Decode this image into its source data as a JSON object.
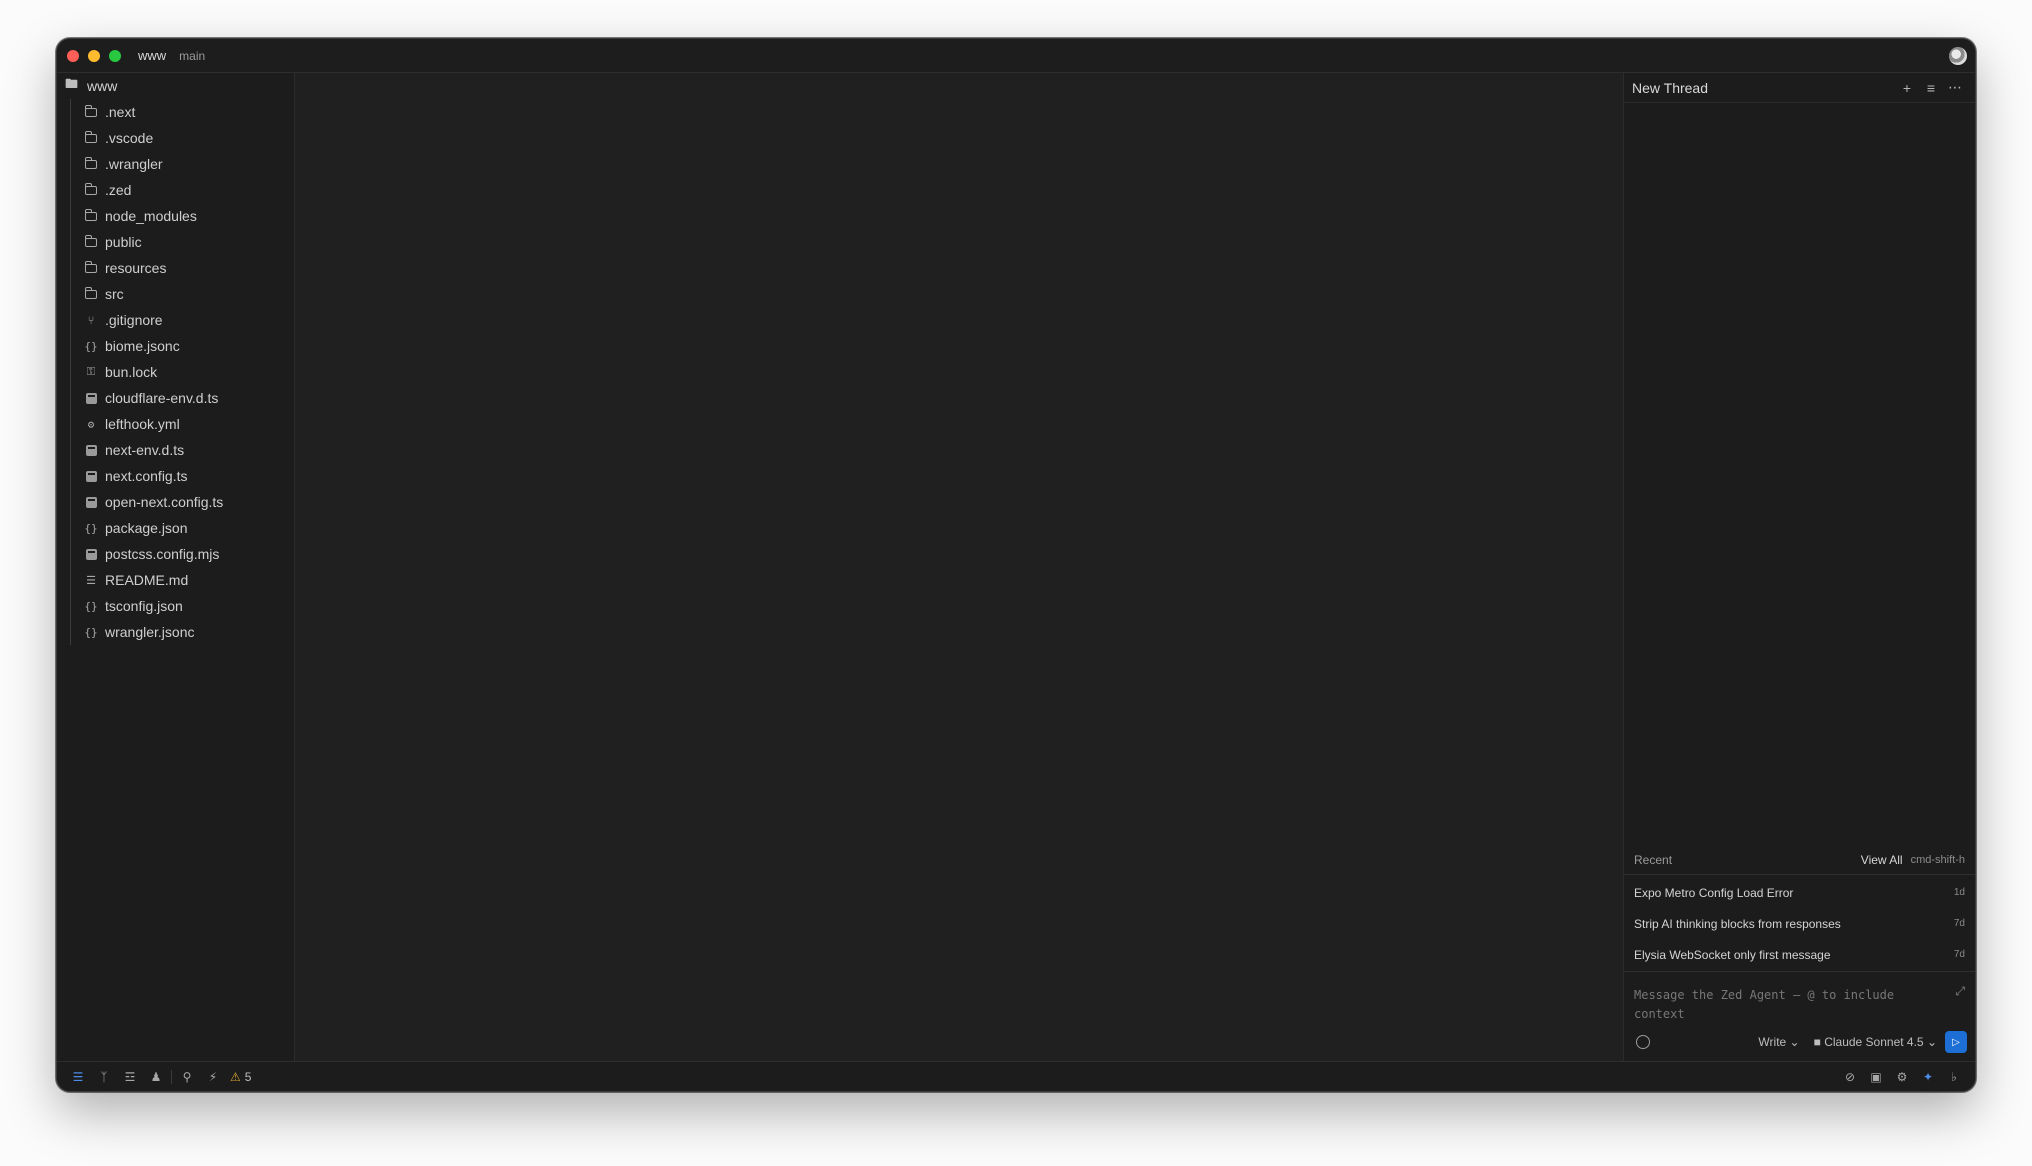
{
  "titlebar": {
    "project": "www",
    "branch": "main"
  },
  "project_panel": {
    "root": "www",
    "items": [
      {
        "label": ".next",
        "kind": "folder"
      },
      {
        "label": ".vscode",
        "kind": "folder"
      },
      {
        "label": ".wrangler",
        "kind": "folder"
      },
      {
        "label": ".zed",
        "kind": "folder"
      },
      {
        "label": "node_modules",
        "kind": "folder"
      },
      {
        "label": "public",
        "kind": "folder"
      },
      {
        "label": "resources",
        "kind": "folder"
      },
      {
        "label": "src",
        "kind": "folder"
      },
      {
        "label": ".gitignore",
        "kind": "git"
      },
      {
        "label": "biome.jsonc",
        "kind": "json"
      },
      {
        "label": "bun.lock",
        "kind": "lock"
      },
      {
        "label": "cloudflare-env.d.ts",
        "kind": "ts"
      },
      {
        "label": "lefthook.yml",
        "kind": "yml"
      },
      {
        "label": "next-env.d.ts",
        "kind": "ts"
      },
      {
        "label": "next.config.ts",
        "kind": "ts"
      },
      {
        "label": "open-next.config.ts",
        "kind": "ts"
      },
      {
        "label": "package.json",
        "kind": "json"
      },
      {
        "label": "postcss.config.mjs",
        "kind": "js"
      },
      {
        "label": "README.md",
        "kind": "md"
      },
      {
        "label": "tsconfig.json",
        "kind": "json"
      },
      {
        "label": "wrangler.jsonc",
        "kind": "json"
      }
    ]
  },
  "agent_panel": {
    "title": "New Thread",
    "recent_label": "Recent",
    "view_all_label": "View All",
    "view_all_shortcut": "cmd-shift-h",
    "recent_threads": [
      {
        "title": "Expo Metro Config Load Error",
        "age": "1d"
      },
      {
        "title": "Strip AI thinking blocks from responses",
        "age": "7d"
      },
      {
        "title": "Elysia WebSocket only first message",
        "age": "7d"
      }
    ],
    "composer_placeholder": "Message the Zed Agent — @ to include context",
    "mode": "Write",
    "model": "Claude Sonnet 4.5"
  },
  "statusbar": {
    "warning_count": "5"
  },
  "colors": {
    "accent": "#1d6fd6",
    "warning": "#d8a52f",
    "background": "#202020"
  }
}
